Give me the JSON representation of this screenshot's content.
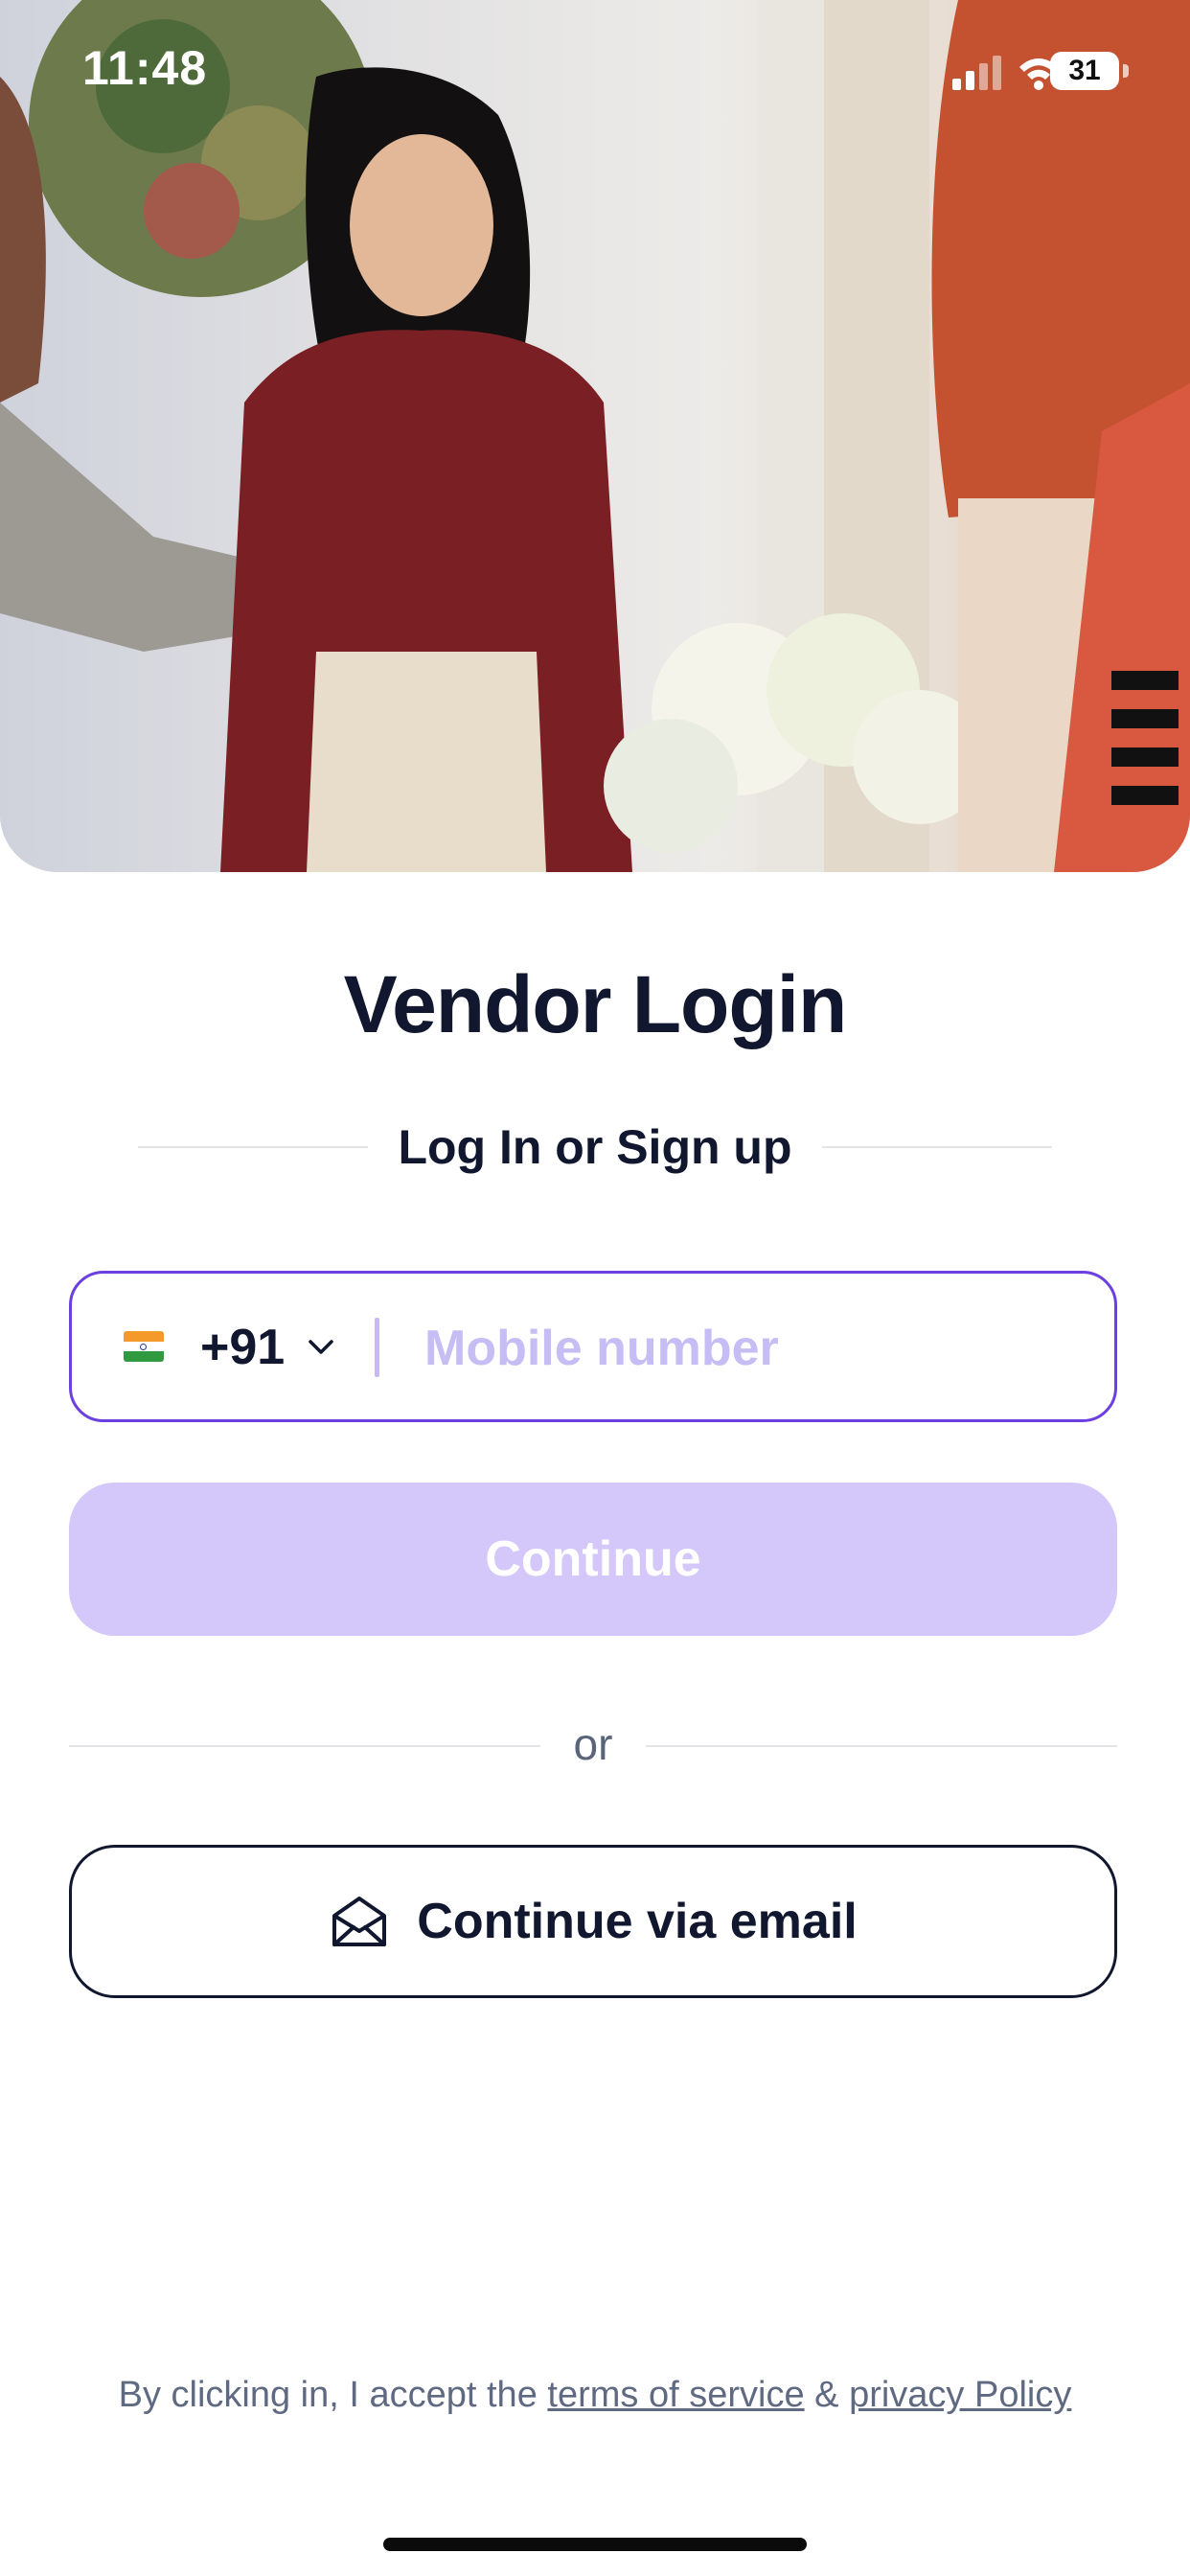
{
  "status_bar": {
    "time": "11:48",
    "battery": "31",
    "icons": [
      "cellular-signal-icon",
      "wifi-icon",
      "battery-icon"
    ]
  },
  "header": {
    "title": "Vendor Login",
    "subtitle": "Log In or Sign up"
  },
  "phone": {
    "country_flag": "india-flag-icon",
    "country_code": "+91",
    "placeholder": "Mobile number",
    "value": ""
  },
  "continue_button": {
    "label": "Continue",
    "enabled": false
  },
  "separator": {
    "label": "or"
  },
  "email_button": {
    "label": "Continue via email",
    "icon": "envelope-icon"
  },
  "legal": {
    "prefix": "By clicking in, I accept the",
    "terms_label": "terms of service",
    "joiner": "&",
    "privacy_label": "privacy Policy"
  },
  "colors": {
    "accent": "#6b3fe0",
    "button_disabled": "#d4c8fa",
    "placeholder": "#c7bdf5",
    "text_dark": "#10172e"
  }
}
